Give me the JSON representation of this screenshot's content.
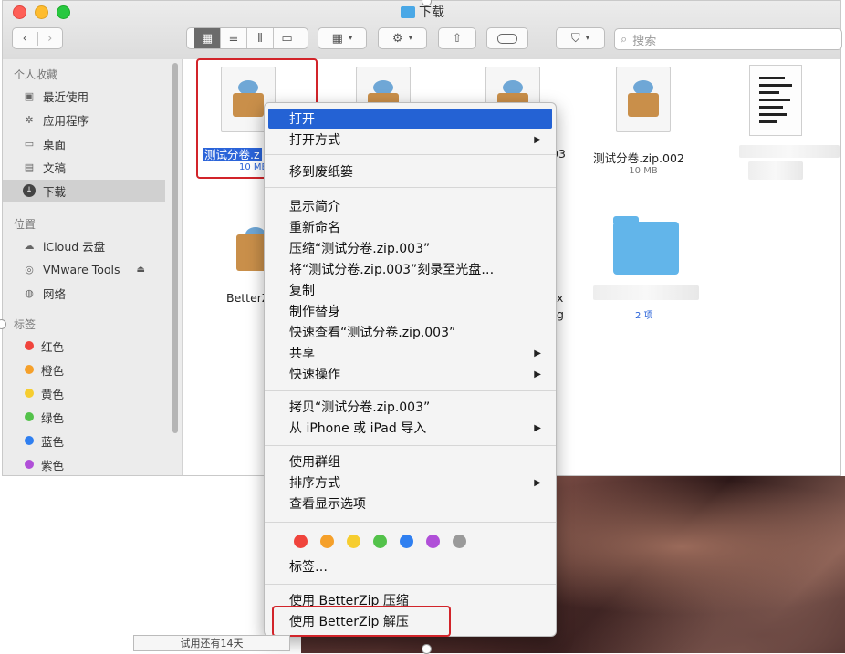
{
  "window": {
    "title": "下载"
  },
  "toolbar": {
    "search_placeholder": "搜索",
    "back_icon": "chevron-left-icon",
    "forward_icon": "chevron-right-icon"
  },
  "sidebar": {
    "favorites_header": "个人收藏",
    "favorites": [
      {
        "label": "最近使用",
        "icon": "clock-icon"
      },
      {
        "label": "应用程序",
        "icon": "apps-icon"
      },
      {
        "label": "桌面",
        "icon": "desktop-icon"
      },
      {
        "label": "文稿",
        "icon": "document-icon"
      },
      {
        "label": "下载",
        "icon": "download-icon",
        "selected": true
      }
    ],
    "locations_header": "位置",
    "locations": [
      {
        "label": "iCloud 云盘",
        "icon": "cloud-icon"
      },
      {
        "label": "VMware Tools",
        "icon": "disc-icon"
      },
      {
        "label": "网络",
        "icon": "globe-icon"
      }
    ],
    "tags_header": "标签",
    "tags": [
      {
        "label": "红色",
        "color": "#f0443c"
      },
      {
        "label": "橙色",
        "color": "#f5a02a"
      },
      {
        "label": "黄色",
        "color": "#f6cd2f"
      },
      {
        "label": "绿色",
        "color": "#53c24a"
      },
      {
        "label": "蓝色",
        "color": "#2f7ff0"
      },
      {
        "label": "紫色",
        "color": "#b04fd8"
      }
    ]
  },
  "files": {
    "selected_name": "测试分卷.z",
    "selected_size": "10 MB",
    "file4_name": "测试分卷.zip.002",
    "file4_size": "10 MB",
    "partial_003": "03",
    "better_partial": "BetterZ",
    "partial_x": "x",
    "partial_g": "g",
    "folder_count": "2 项"
  },
  "context_menu": {
    "open": "打开",
    "open_with": "打开方式",
    "trash": "移到废纸篓",
    "get_info": "显示简介",
    "rename": "重新命名",
    "compress": "压缩“测试分卷.zip.003”",
    "burn": "将“测试分卷.zip.003”刻录至光盘…",
    "duplicate": "复制",
    "make_alias": "制作替身",
    "quick_look": "快速查看“测试分卷.zip.003”",
    "share": "共享",
    "quick_actions": "快速操作",
    "copy": "拷贝“测试分卷.zip.003”",
    "import_iphone": "从 iPhone 或 iPad 导入",
    "use_groups": "使用群组",
    "sort_by": "排序方式",
    "view_options": "查看显示选项",
    "tag_colors": [
      "#f0443c",
      "#f5a02a",
      "#f6cd2f",
      "#53c24a",
      "#2f7ff0",
      "#b04fd8",
      "#9a9a9a"
    ],
    "tags": "标签…",
    "betterzip_compress": "使用 BetterZip 压缩",
    "betterzip_extract": "使用 BetterZip 解压"
  },
  "status": {
    "text": "试用还有14天"
  }
}
